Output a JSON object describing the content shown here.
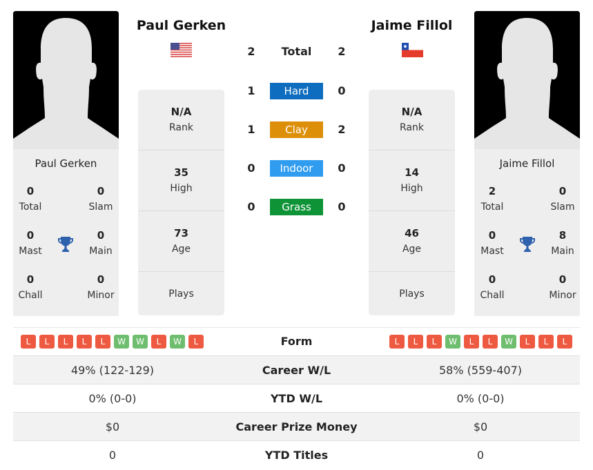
{
  "player1": {
    "name": "Paul Gerken",
    "photo_caption": "Paul Gerken",
    "flag": "usa-flag-icon",
    "rank": {
      "value": "N/A",
      "label": "Rank"
    },
    "high": {
      "value": "35",
      "label": "High"
    },
    "age": {
      "value": "73",
      "label": "Age"
    },
    "plays": {
      "label": "Plays"
    },
    "titles": {
      "total": {
        "value": "0",
        "label": "Total"
      },
      "slam": {
        "value": "0",
        "label": "Slam"
      },
      "mast": {
        "value": "0",
        "label": "Mast"
      },
      "main": {
        "value": "0",
        "label": "Main"
      },
      "chall": {
        "value": "0",
        "label": "Chall"
      },
      "minor": {
        "value": "0",
        "label": "Minor"
      }
    },
    "form": [
      "L",
      "L",
      "L",
      "L",
      "L",
      "W",
      "W",
      "L",
      "W",
      "L"
    ]
  },
  "player2": {
    "name": "Jaime Fillol",
    "photo_caption": "Jaime Fillol",
    "flag": "chile-flag-icon",
    "rank": {
      "value": "N/A",
      "label": "Rank"
    },
    "high": {
      "value": "14",
      "label": "High"
    },
    "age": {
      "value": "46",
      "label": "Age"
    },
    "plays": {
      "label": "Plays"
    },
    "titles": {
      "total": {
        "value": "2",
        "label": "Total"
      },
      "slam": {
        "value": "0",
        "label": "Slam"
      },
      "mast": {
        "value": "0",
        "label": "Mast"
      },
      "main": {
        "value": "8",
        "label": "Main"
      },
      "chall": {
        "value": "0",
        "label": "Chall"
      },
      "minor": {
        "value": "0",
        "label": "Minor"
      }
    },
    "form": [
      "L",
      "L",
      "L",
      "W",
      "L",
      "L",
      "W",
      "L",
      "L",
      "L"
    ]
  },
  "h2h": {
    "total": {
      "label": "Total",
      "p1": "2",
      "p2": "2"
    },
    "surfaces": [
      {
        "label": "Hard",
        "p1": "1",
        "p2": "0",
        "color": "#0f6dbf"
      },
      {
        "label": "Clay",
        "p1": "1",
        "p2": "2",
        "color": "#dd8f0a"
      },
      {
        "label": "Indoor",
        "p1": "0",
        "p2": "0",
        "color": "#2f9cf0"
      },
      {
        "label": "Grass",
        "p1": "0",
        "p2": "0",
        "color": "#0e9437"
      }
    ]
  },
  "form_label": "Form",
  "stats": [
    {
      "label": "Career W/L",
      "p1": "49% (122-129)",
      "p2": "58% (559-407)"
    },
    {
      "label": "YTD W/L",
      "p1": "0% (0-0)",
      "p2": "0% (0-0)"
    },
    {
      "label": "Career Prize Money",
      "p1": "$0",
      "p2": "$0"
    },
    {
      "label": "YTD Titles",
      "p1": "0",
      "p2": "0"
    }
  ],
  "colors": {
    "loss": "#ee5a41",
    "win": "#6fbe6f",
    "trophy": "#2f62ad"
  }
}
